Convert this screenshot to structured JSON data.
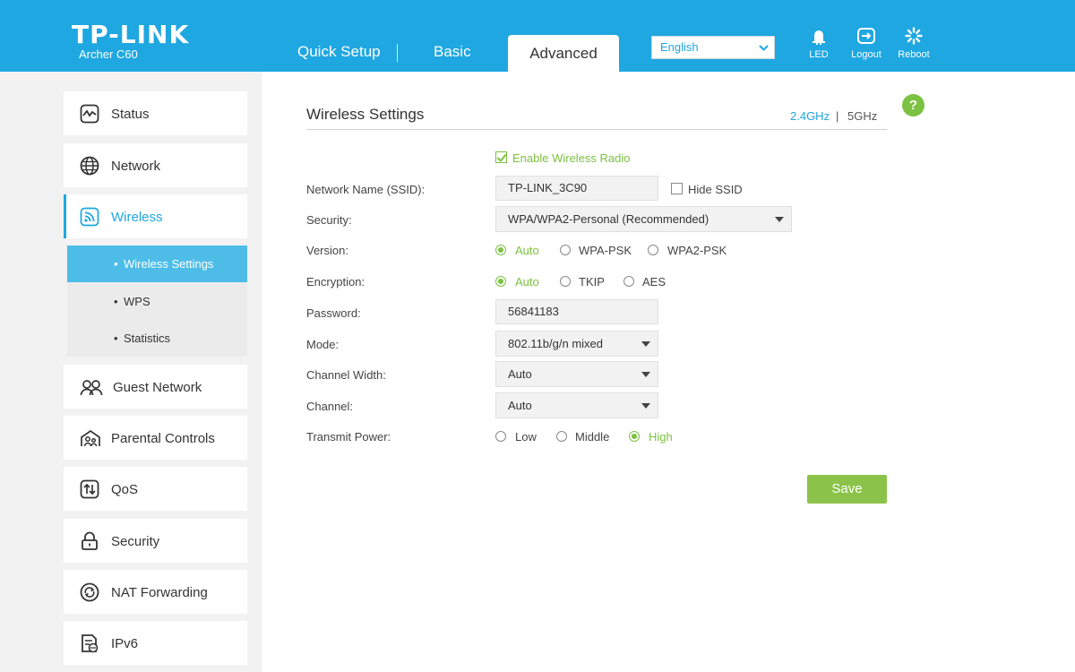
{
  "header": {
    "brand": "TP-LINK",
    "model": "Archer C60",
    "tabs": {
      "quick_setup": "Quick Setup",
      "basic": "Basic",
      "advanced": "Advanced"
    },
    "language": "English",
    "icons": {
      "led": "LED",
      "logout": "Logout",
      "reboot": "Reboot"
    }
  },
  "sidebar": {
    "items": {
      "status": "Status",
      "network": "Network",
      "wireless": "Wireless",
      "guest": "Guest Network",
      "parental": "Parental Controls",
      "qos": "QoS",
      "security": "Security",
      "nat": "NAT Forwarding",
      "ipv6": "IPv6"
    },
    "wireless_sub": {
      "settings": "Wireless Settings",
      "wps": "WPS",
      "statistics": "Statistics"
    }
  },
  "main": {
    "title": "Wireless Settings",
    "band_24": "2.4GHz",
    "band_sep": "|",
    "band_5": "5GHz",
    "help": "?",
    "enable_radio": "Enable Wireless Radio",
    "labels": {
      "ssid": "Network Name (SSID):",
      "security": "Security:",
      "version": "Version:",
      "encryption": "Encryption:",
      "password": "Password:",
      "mode": "Mode:",
      "channel_width": "Channel Width:",
      "channel": "Channel:",
      "transmit_power": "Transmit Power:"
    },
    "values": {
      "ssid": "TP-LINK_3C90",
      "hide_ssid": "Hide SSID",
      "security": "WPA/WPA2-Personal (Recommended)",
      "password": "56841183",
      "mode": "802.11b/g/n mixed",
      "channel_width": "Auto",
      "channel": "Auto"
    },
    "version_options": [
      "Auto",
      "WPA-PSK",
      "WPA2-PSK"
    ],
    "encryption_options": [
      "Auto",
      "TKIP",
      "AES"
    ],
    "power_options": [
      "Low",
      "Middle",
      "High"
    ],
    "save": "Save"
  },
  "colors": {
    "header_blue": "#1fa7e1",
    "accent_green": "#7cc142",
    "save_green": "#8bc34a",
    "active_sub": "#4dbde8"
  }
}
